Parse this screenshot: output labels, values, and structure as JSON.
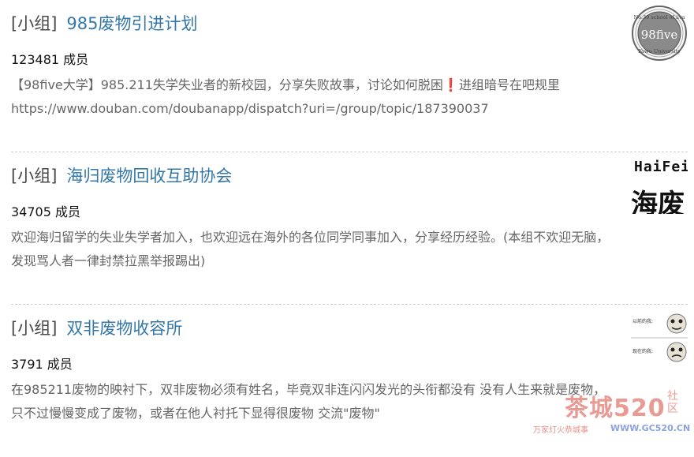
{
  "groups": [
    {
      "tag": "[小组]",
      "name": "985废物引进计划",
      "members": "123481 成员",
      "description_part1": "【98five大学】985.211失学失业者的新校园，分享失败故事，讨论如何脱困",
      "description_mark": "❗",
      "description_part2": "进组暗号在吧规里https://www.douban.com/doubanapp/dispatch?uri=/group/topic/187390037",
      "thumb_text_main": "98five",
      "thumb_text_top": "No.39 school of iiva",
      "thumb_text_bottom": "Fawu University"
    },
    {
      "tag": "[小组]",
      "name": "海归废物回收互助协会",
      "members": "34705 成员",
      "description": "欢迎海归留学的失业失学者加入，也欢迎远在海外的各位同学同事加入，分享经历经验。(本组不欢迎无脑，发现骂人者一律封禁拉黑举报踢出)",
      "thumb_title": "HaiFei",
      "thumb_main": "海废"
    },
    {
      "tag": "[小组]",
      "name": "双非废物收容所",
      "members": "3791 成员",
      "description": "在985211废物的映衬下，双非废物必须有姓名，毕竟双非连闪闪发光的头衔都没有 没有人生来就是废物，只不过慢慢变成了废物，或者在他人衬托下显得很废物 交流\"废物\"",
      "thumb_label_top": "以前的我:",
      "thumb_label_bottom": "现在的我:"
    }
  ],
  "watermark": {
    "main": "茶城520",
    "side": "社区",
    "sub": "万家灯火恭城事",
    "url": "WWW.GC520.CN"
  }
}
